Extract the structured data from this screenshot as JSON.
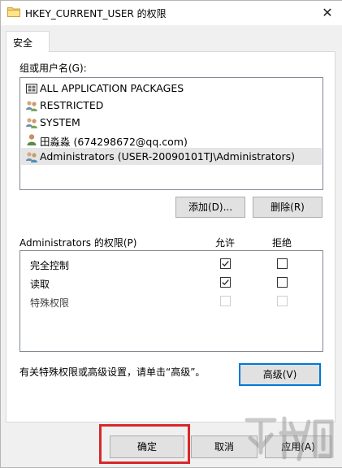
{
  "window": {
    "title": "HKEY_CURRENT_USER 的权限",
    "close_glyph": "✕"
  },
  "tabs": [
    {
      "label": "安全"
    }
  ],
  "groups": {
    "label": "组或用户名(G):",
    "items": [
      {
        "name": "ALL APPLICATION PACKAGES",
        "icon": "app-packages-icon",
        "selected": false
      },
      {
        "name": "RESTRICTED",
        "icon": "group-icon",
        "selected": false
      },
      {
        "name": "SYSTEM",
        "icon": "group-icon",
        "selected": false
      },
      {
        "name": "田淼淼 (674298672@qq.com)",
        "icon": "user-icon",
        "selected": false
      },
      {
        "name": "Administrators (USER-20090101TJ\\Administrators)",
        "icon": "group-icon",
        "selected": true
      }
    ]
  },
  "buttons": {
    "add": "添加(D)...",
    "remove": "删除(R)",
    "advanced": "高级(V)",
    "ok": "确定",
    "cancel": "取消",
    "apply": "应用(A)"
  },
  "permissions": {
    "label": "Administrators 的权限(P)",
    "allow_header": "允许",
    "deny_header": "拒绝",
    "rows": [
      {
        "label": "完全控制",
        "allow": true,
        "deny": false,
        "disabled": false
      },
      {
        "label": "读取",
        "allow": true,
        "deny": false,
        "disabled": false
      },
      {
        "label": "特殊权限",
        "allow": false,
        "deny": false,
        "disabled": true
      }
    ]
  },
  "advanced_hint": "有关特殊权限或高级设置，请单击“高级”。",
  "colors": {
    "highlight_box": "#d9282a",
    "focus_border": "#0078d7"
  }
}
